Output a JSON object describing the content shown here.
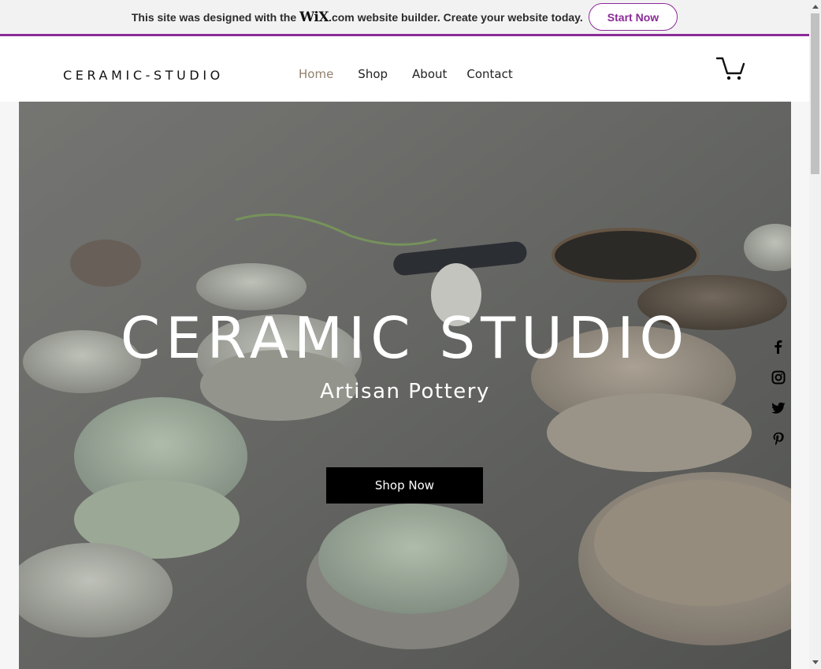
{
  "banner": {
    "text_before": "This site was designed with the",
    "logo": "WiX",
    "dotcom": ".com",
    "text_after": "website builder. Create your website today.",
    "cta_label": "Start Now",
    "accent_color": "#8b2a98"
  },
  "header": {
    "site_title": "CERAMIC-STUDIO",
    "nav": [
      {
        "label": "Home",
        "active": true
      },
      {
        "label": "Shop",
        "active": false
      },
      {
        "label": "About",
        "active": false
      },
      {
        "label": "Contact",
        "active": false
      }
    ],
    "cart_icon": "cart-icon"
  },
  "hero": {
    "title": "CERAMIC STUDIO",
    "subtitle": "Artisan Pottery",
    "cta_label": "Shop Now"
  },
  "social": [
    {
      "icon": "facebook-icon"
    },
    {
      "icon": "instagram-icon"
    },
    {
      "icon": "twitter-icon"
    },
    {
      "icon": "pinterest-icon"
    }
  ]
}
